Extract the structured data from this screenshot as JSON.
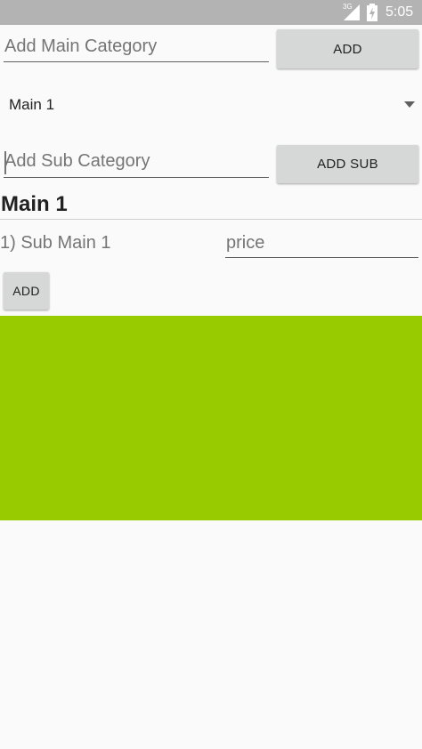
{
  "status_bar": {
    "network": "3G",
    "time": "5:05"
  },
  "main_category": {
    "placeholder": "Add Main Category",
    "add_label": "ADD"
  },
  "spinner": {
    "selected": "Main 1"
  },
  "sub_category": {
    "placeholder": "Add Sub Category",
    "add_label": "ADD SUB"
  },
  "section": {
    "heading": "Main 1",
    "items": [
      {
        "label": "1) Sub Main 1",
        "price_placeholder": "price"
      }
    ],
    "add_label": "ADD"
  },
  "colors": {
    "status_bar": "#b3b3b3",
    "green_block": "#99cc00",
    "button": "#d6d7d7"
  }
}
